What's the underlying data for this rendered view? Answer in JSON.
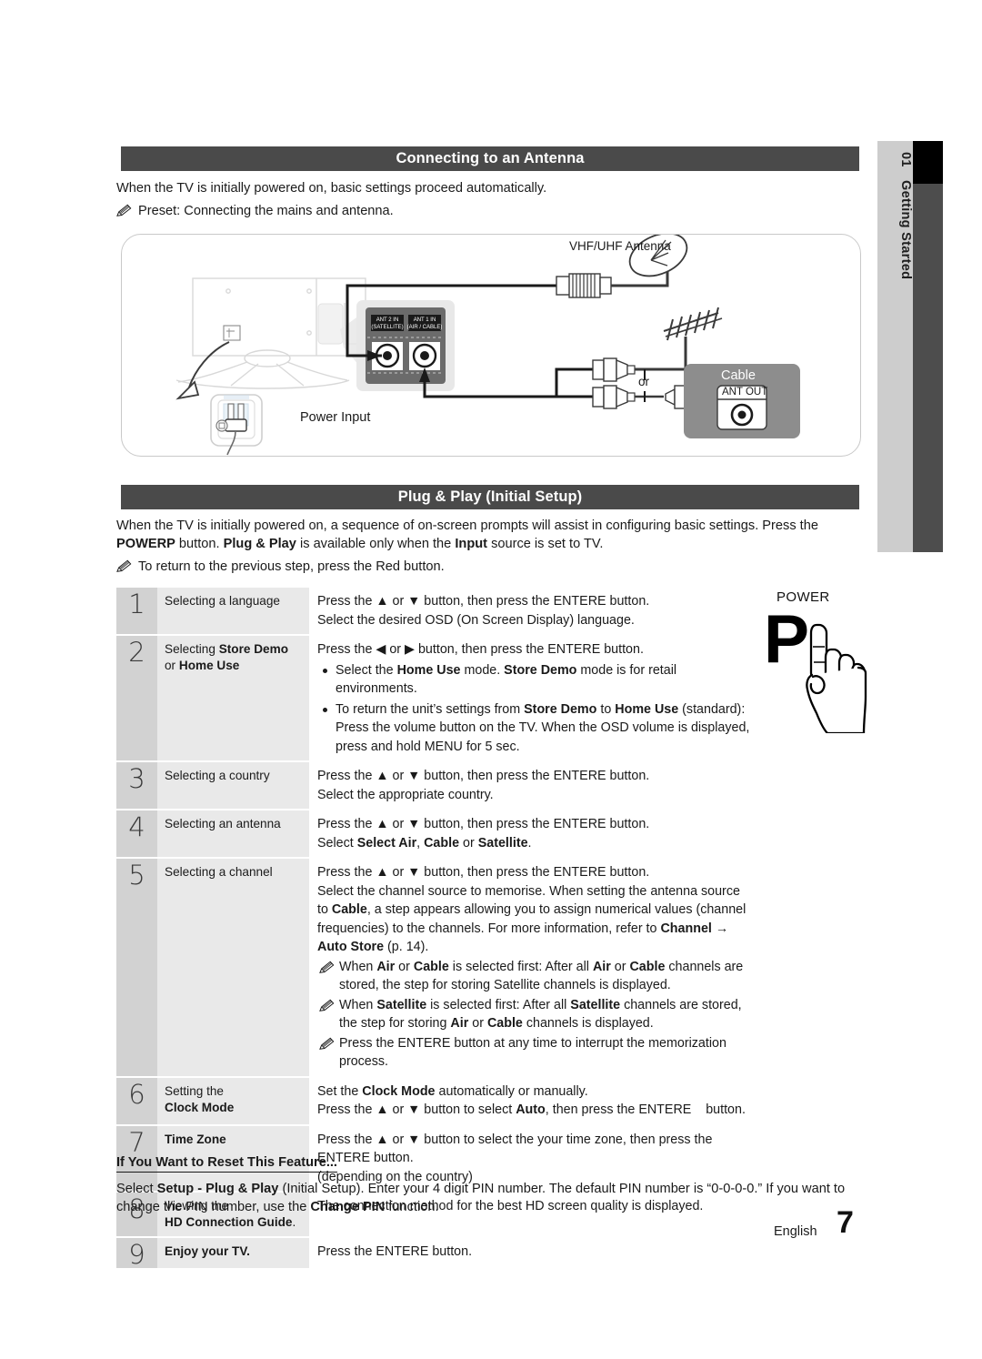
{
  "sidetab": {
    "number": "01",
    "label": "Getting Started"
  },
  "section1": {
    "title": "Connecting to an Antenna",
    "paragraph": "When the TV is initially powered on, basic settings proceed automatically.",
    "note": "Preset: Connecting the mains and antenna."
  },
  "diagram": {
    "labels": {
      "vhf_uhf_antenna": "VHF/UHF Antenna",
      "power_input": "Power Input",
      "or": "or",
      "cable": "Cable",
      "ant_out": "ANT OUT",
      "ant2_in_line1": "ANT 2 IN",
      "ant2_in_line2": "(SATELLITE)",
      "ant1_in_line1": "ANT 1 IN",
      "ant1_in_line2": "(AIR / CABLE)"
    }
  },
  "section2": {
    "title": "Plug & Play (Initial Setup)",
    "intro_1": "When the TV is initially powered on, a sequence of on-screen prompts will assist in configuring basic settings. Press the ",
    "intro_power": "POWERP",
    "intro_2": " button. ",
    "intro_plugplay": "Plug & Play",
    "intro_3": " is available only when the ",
    "intro_input": "Input",
    "intro_4": " source is set to TV.",
    "note": "To return to the previous step, press the Red button."
  },
  "power_graphic": {
    "label": "POWER",
    "letter": "P"
  },
  "steps": [
    {
      "num": "1",
      "label_plain": "Selecting a language",
      "lines": [
        "Press the ▲ or ▼ button, then press the ENTERE    button.",
        "Select the desired OSD (On Screen Display) language."
      ]
    },
    {
      "num": "2",
      "label_pre": "Selecting ",
      "label_bold": "Store Demo",
      "label_line2_pre": "or ",
      "label_line2_bold": "Home Use",
      "line1": "Press the ◀ or ▶ button, then press the ENTERE    button.",
      "bullets": [
        "Select the Home Use mode. Store Demo mode is for retail environments.",
        "To return the unit’s settings from Store Demo to Home Use (standard): Press the volume button on the TV. When the OSD volume is displayed, press and hold MENU for 5 sec."
      ]
    },
    {
      "num": "3",
      "label_plain": "Selecting a country",
      "lines": [
        "Press the ▲ or ▼ button, then press the ENTERE    button.",
        "Select the appropriate country."
      ]
    },
    {
      "num": "4",
      "label_plain": "Selecting an antenna",
      "lines": [
        "Press the ▲ or ▼ button, then press the ENTERE    button.",
        "Select Select Air, Cable or Satellite."
      ]
    },
    {
      "num": "5",
      "label_plain": "Selecting a channel",
      "line1": "Press the ▲ or ▼ button, then press the ENTERE    button.",
      "body": "Select the channel source to memorise. When setting the antenna source to Cable, a step appears allowing you to assign numerical values (channel frequencies) to the channels. For more information, refer to Channel → Auto Store (p. 14).",
      "notes": [
        "When Air or Cable is selected first: After all Air or Cable channels are stored, the step for storing Satellite channels is displayed.",
        "When Satellite is selected first: After all Satellite channels are stored, the step for storing Air or Cable channels is displayed.",
        "Press the ENTERE    button at any time to interrupt the memorization process."
      ]
    },
    {
      "num": "6",
      "label_line1": "Setting the",
      "label_line2_bold": "Clock Mode",
      "lines": [
        "Set the Clock Mode automatically or manually.",
        "Press the ▲ or ▼ button to select Auto, then press the ENTERE    button."
      ]
    },
    {
      "num": "7",
      "label_bold_only": "Time Zone",
      "lines": [
        "Press the ▲ or ▼ button to select the your time zone, then press the ENTERE    button.",
        "(depending on the country)"
      ]
    },
    {
      "num": "8",
      "label_line1": "Viewing the",
      "label_line2_bold": "HD Connection Guide",
      "label_line2_tail": ".",
      "lines": [
        "The connection method for the best HD screen quality is displayed."
      ]
    },
    {
      "num": "9",
      "label_bold_only": "Enjoy your TV.",
      "lines": [
        "Press the ENTERE    button."
      ]
    }
  ],
  "reset": {
    "title": "If You Want to Reset This Feature...",
    "line_a1": "Select ",
    "line_a_bold": "Setup - Plug & Play",
    "line_a2": " (Initial Setup). Enter your 4 digit PIN number. The default PIN number is “0-0-0-0.” If you want to",
    "line_b1": "change the PIN number, use the ",
    "line_b_bold": "Change PIN",
    "line_b2": " function."
  },
  "footer": {
    "language": "English",
    "page": "7"
  },
  "colors": {
    "bar": "#4a4a4a",
    "num_cell": "#d2d2d2",
    "label_cell": "#e9e9e9",
    "sidetab_light": "#cdcdcd",
    "sidetab_dark": "#4d4d4d"
  }
}
